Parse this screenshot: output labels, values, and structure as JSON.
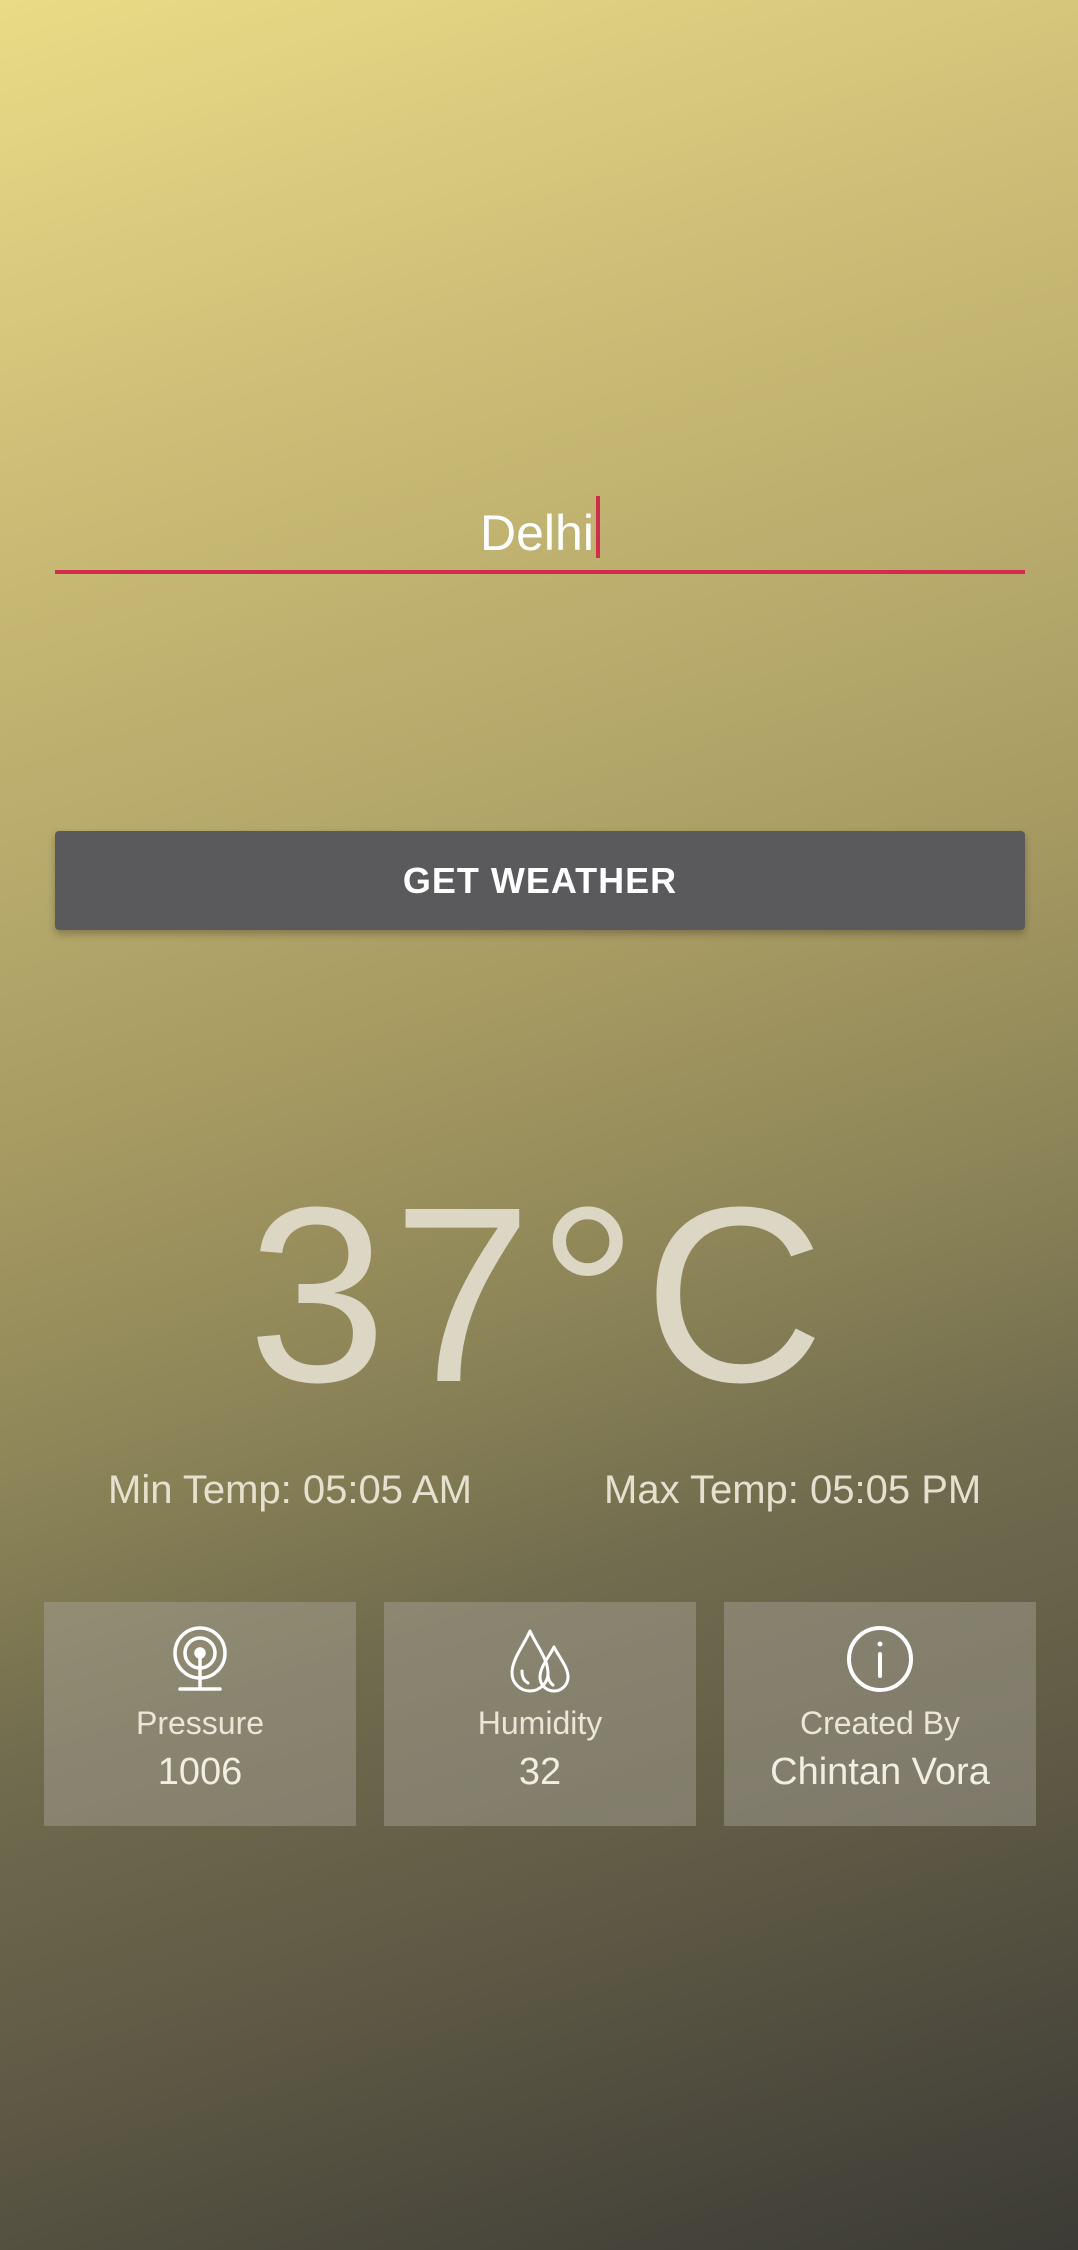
{
  "search": {
    "city_value": "Delhi"
  },
  "actions": {
    "get_weather_label": "GET WEATHER"
  },
  "weather": {
    "temperature": "37°C",
    "min_temp": "Min Temp: 05:05 AM",
    "max_temp": "Max Temp: 05:05 PM"
  },
  "cards": {
    "pressure": {
      "icon": "pressure-icon",
      "label": "Pressure",
      "value": "1006"
    },
    "humidity": {
      "icon": "humidity-icon",
      "label": "Humidity",
      "value": "32"
    },
    "created": {
      "icon": "info-icon",
      "label": "Created By",
      "value": "Chintan Vora"
    }
  },
  "colors": {
    "accent": "#d12c4c",
    "button": "#5a5a5c"
  }
}
